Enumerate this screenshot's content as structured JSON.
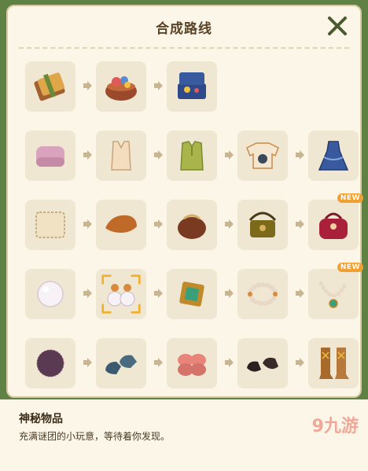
{
  "panel": {
    "title": "合成路线"
  },
  "rows": [
    [
      "notebook-icon",
      "sewing-basket-icon",
      "jewelry-box-icon"
    ],
    [
      "folded-cloth-icon",
      "tank-top-icon",
      "green-blouse-icon",
      "cat-sweater-icon",
      "blue-dress-icon"
    ],
    [
      "fabric-scrap-icon",
      "leather-scrap-icon",
      "coin-purse-icon",
      "shoulder-bag-icon",
      "red-handbag-icon"
    ],
    [
      "pearl-icon",
      "pearl-earrings-icon",
      "emerald-pendant-icon",
      "bead-bracelet-icon",
      "emerald-necklace-icon"
    ],
    [
      "yarn-ball-icon",
      "blue-loafers-icon",
      "pink-slippers-icon",
      "black-shoes-icon",
      "tall-boots-icon"
    ]
  ],
  "badges": {
    "row3": "NEW",
    "row4": "NEW"
  },
  "selected": {
    "row": 3,
    "col": 1
  },
  "info": {
    "name": "神秘物品",
    "description": "充满谜团的小玩意，等待着你发现。"
  },
  "watermark": "九游",
  "colors": {
    "frame": "#5f8244",
    "card": "#fbf6e8",
    "cell": "#efe7d2",
    "arrow": "#c8b592",
    "select": "#f0b030"
  }
}
